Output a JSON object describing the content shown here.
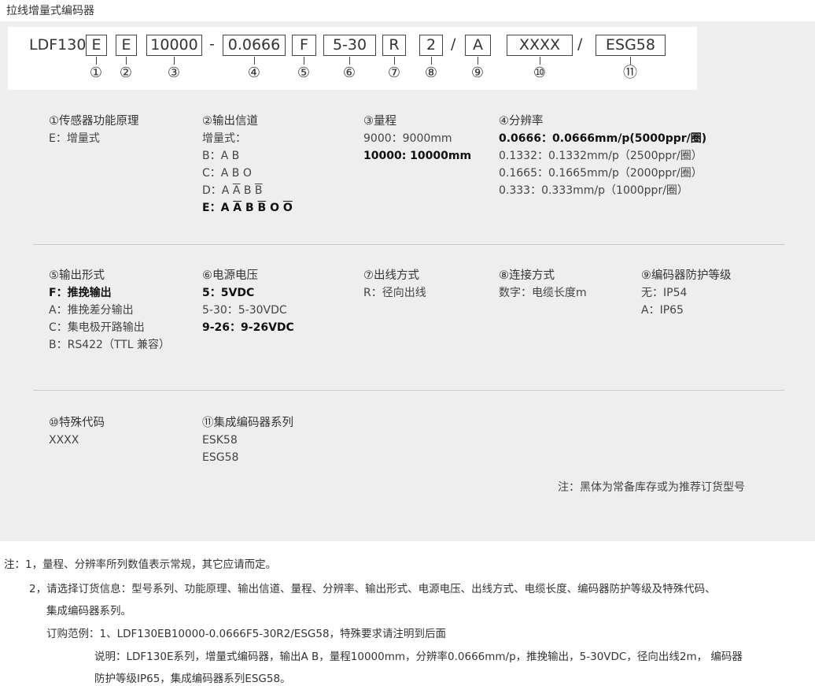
{
  "title": "拉线增量式编码器",
  "code": {
    "prefix": "LDF130",
    "seg_principle": "E",
    "seg_channel": "E",
    "seg_range": "10000",
    "dash": "-",
    "seg_resolution": "0.0666",
    "seg_output": "F",
    "seg_voltage": "5-30",
    "seg_exit": "R",
    "seg_cable": "2",
    "slash1": "/",
    "seg_protection": "A",
    "seg_special": "XXXX",
    "slash2": "/",
    "seg_series": "ESG58",
    "markers": [
      "①",
      "②",
      "③",
      "④",
      "⑤",
      "⑥",
      "⑦",
      "⑧",
      "⑨",
      "⑩",
      "⑪"
    ]
  },
  "spec": {
    "principle": {
      "header": "①传感器功能原理",
      "lines": [
        "E：增量式"
      ]
    },
    "channel": {
      "header": "②输出信道",
      "line0": "增量式：",
      "line1": "B：A B",
      "line2": "C：A B O",
      "d_prefix": "D：A ",
      "d_a": "A",
      "d_b": "B",
      "d_bbar": "B",
      "e_prefix": "E：A ",
      "e_abar": "A",
      "e_b": "B",
      "e_bbar": "B",
      "e_o": "O",
      "e_obar": "O"
    },
    "range": {
      "header": "③量程",
      "line0": "9000：9000mm",
      "line1": "10000: 10000mm"
    },
    "resolution": {
      "header": "④分辨率",
      "line0": "0.0666：0.0666mm/p(5000ppr/圈)",
      "line1": "0.1332：0.1332mm/p（2500ppr/圈）",
      "line2": "0.1665：0.1665mm/p（2000ppr/圈）",
      "line3": "0.333：0.333mm/p（1000ppr/圈）"
    },
    "output": {
      "header": "⑤输出形式",
      "line0": "F：推挽输出",
      "line1": "A：推挽差分输出",
      "line2": "C：集电极开路输出",
      "line3": "B：RS422（TTL 兼容）"
    },
    "voltage": {
      "header": "⑥电源电压",
      "line0": "5：5VDC",
      "line1": "5-30：5-30VDC",
      "line2": "9-26：9-26VDC"
    },
    "exit": {
      "header": "⑦出线方式",
      "line0": "R：径向出线"
    },
    "connection": {
      "header": "⑧连接方式",
      "line0": "数字：电缆长度m"
    },
    "protection": {
      "header": "⑨编码器防护等级",
      "line0": "无：IP54",
      "line1": "A：IP65"
    },
    "special": {
      "header": "⑩特殊代码",
      "line0": "XXXX"
    },
    "series": {
      "header": "⑪集成编码器系列",
      "line0": "ESK58",
      "line1": "ESG58"
    },
    "stock_note": "注：黑体为常备库存或为推荐订货型号"
  },
  "notes": {
    "n1": "注：1，量程、分辨率所列数值表示常规，其它应请而定。",
    "n2a": "2，请选择订货信息：型号系列、功能原理、输出信道、量程、分辨率、输出形式、电源电压、出线方式、电缆长度、编码器防护等级及特殊代码、",
    "n2b": "集成编码器系列。",
    "example": "订购范例：1、LDF130EB10000-0.0666F5-30R2/ESG58，特殊要求请注明到后面",
    "desc_a": "说明：LDF130E系列，增量式编码器，输出A B，量程10000mm，分辨率0.0666mm/p，推挽输出，5-30VDC，径向出线2m， 编码器",
    "desc_b": "防护等级IP65，集成编码器系列ESG58。"
  }
}
